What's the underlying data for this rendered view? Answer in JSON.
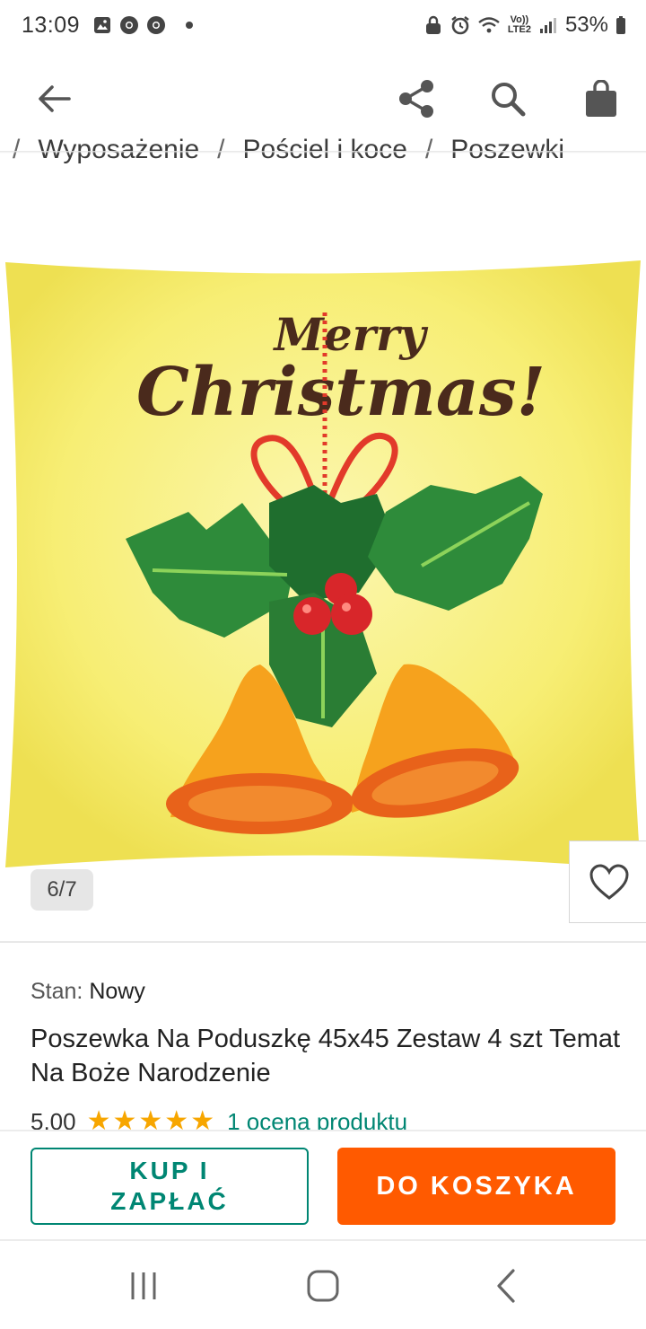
{
  "status_bar": {
    "time": "13:09",
    "battery": "53%",
    "network_line1": "Vo))",
    "network_line2": "LTE2"
  },
  "app_bar": {
    "back_icon": "arrow-left-icon",
    "share_icon": "share-icon",
    "search_icon": "search-icon",
    "bag_icon": "shopping-bag-icon"
  },
  "breadcrumb": {
    "items": [
      "Wyposażenie",
      "Pościel i koce",
      "Poszewki"
    ],
    "separator": "/"
  },
  "gallery": {
    "counter": "6/7",
    "image_text_line1": "Merry",
    "image_text_line2": "Christmas!",
    "favorite_icon": "heart-icon"
  },
  "product": {
    "condition_label": "Stan:",
    "condition_value": "Nowy",
    "title": "Poszewka Na Poduszkę 45x45 Zestaw 4 szt Temat Na Boże Narodzenie",
    "rating_score": "5,00",
    "rating_stars": 5,
    "rating_link": "1 ocena produktu"
  },
  "actions": {
    "buy_now_label": "KUP I ZAPŁAĆ",
    "add_to_cart_label": "DO KOSZYKA"
  },
  "colors": {
    "accent_teal": "#008673",
    "cta_orange": "#ff5a00",
    "star_yellow": "#f7a600"
  }
}
